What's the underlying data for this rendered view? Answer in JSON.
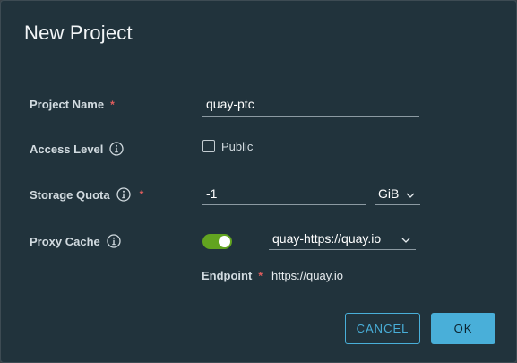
{
  "dialog": {
    "title": "New Project"
  },
  "project_name": {
    "label": "Project Name",
    "required_mark": "*",
    "value": "quay-ptc"
  },
  "access_level": {
    "label": "Access Level",
    "icon": "info-icon",
    "checkbox_label": "Public",
    "checked": false
  },
  "storage_quota": {
    "label": "Storage Quota",
    "icon": "info-icon",
    "required_mark": "*",
    "value": "-1",
    "unit": "GiB"
  },
  "proxy_cache": {
    "label": "Proxy Cache",
    "icon": "info-icon",
    "enabled": true,
    "registry": "quay-https://quay.io"
  },
  "endpoint": {
    "label": "Endpoint",
    "required_mark": "*",
    "value": "https://quay.io"
  },
  "buttons": {
    "cancel": "CANCEL",
    "ok": "OK"
  },
  "colors": {
    "background": "#21333c",
    "accent": "#49afd9",
    "toggle_on": "#62a420",
    "required": "#e25d5d"
  }
}
